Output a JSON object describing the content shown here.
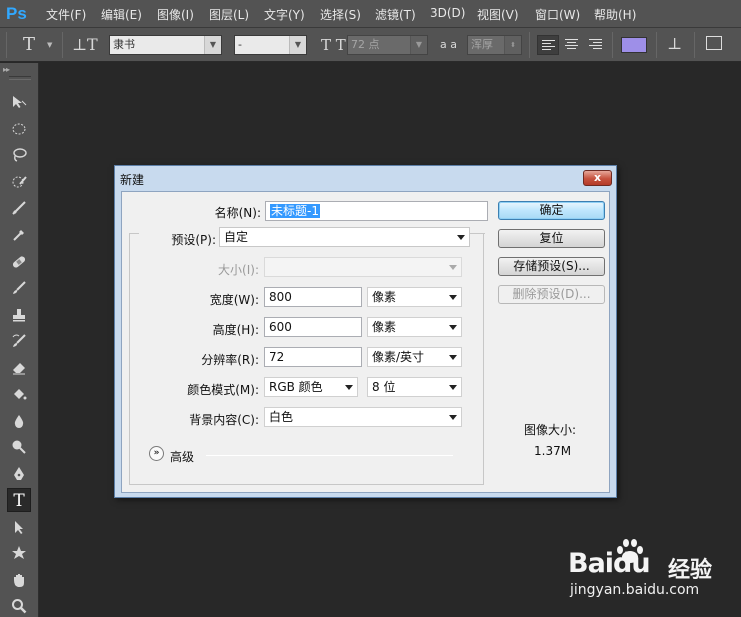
{
  "app": {
    "logo": "Ps"
  },
  "menu": [
    {
      "label": "文件(F)",
      "key": "file"
    },
    {
      "label": "编辑(E)",
      "key": "edit"
    },
    {
      "label": "图像(I)",
      "key": "image"
    },
    {
      "label": "图层(L)",
      "key": "layer"
    },
    {
      "label": "文字(Y)",
      "key": "type"
    },
    {
      "label": "选择(S)",
      "key": "select"
    },
    {
      "label": "滤镜(T)",
      "key": "filter"
    },
    {
      "label": "3D(D)",
      "key": "3d"
    },
    {
      "label": "视图(V)",
      "key": "view"
    },
    {
      "label": "窗口(W)",
      "key": "window"
    },
    {
      "label": "帮助(H)",
      "key": "help"
    }
  ],
  "options_bar": {
    "font_family": "隶书",
    "font_style": "-",
    "font_size": "72 点",
    "aa_icon": "a a",
    "antialias": "浑厚",
    "text_color": "#9e8fe8"
  },
  "toolbox": {
    "grip": "▸▸",
    "tools": [
      {
        "name": "move-tool",
        "icon": "move-icon"
      },
      {
        "name": "marquee-tool",
        "icon": "ellipse-marquee-icon"
      },
      {
        "name": "lasso-tool",
        "icon": "lasso-icon"
      },
      {
        "name": "quick-select-tool",
        "icon": "quick-select-icon"
      },
      {
        "name": "crop-tool",
        "icon": "crop-icon"
      },
      {
        "name": "eyedropper-tool",
        "icon": "eyedropper-icon"
      },
      {
        "name": "healing-tool",
        "icon": "bandage-icon"
      },
      {
        "name": "brush-tool",
        "icon": "brush-icon"
      },
      {
        "name": "stamp-tool",
        "icon": "stamp-icon"
      },
      {
        "name": "history-brush-tool",
        "icon": "history-brush-icon"
      },
      {
        "name": "eraser-tool",
        "icon": "eraser-icon"
      },
      {
        "name": "paint-bucket-tool",
        "icon": "paint-bucket-icon"
      },
      {
        "name": "blur-tool",
        "icon": "drop-icon"
      },
      {
        "name": "dodge-tool",
        "icon": "dodge-icon"
      },
      {
        "name": "pen-tool",
        "icon": "pen-icon"
      },
      {
        "name": "type-tool",
        "icon": "type-icon",
        "active": true
      },
      {
        "name": "path-select-tool",
        "icon": "arrow-icon"
      },
      {
        "name": "shape-tool",
        "icon": "custom-shape-icon"
      },
      {
        "name": "hand-tool",
        "icon": "hand-icon"
      },
      {
        "name": "zoom-tool",
        "icon": "magnifier-icon"
      }
    ]
  },
  "dialog": {
    "title": "新建",
    "close": "x",
    "name_label": "名称(N):",
    "name_value": "未标题-1",
    "preset_label": "预设(P):",
    "preset_value": "自定",
    "size_label": "大小(I):",
    "width_label": "宽度(W):",
    "width_value": "800",
    "width_unit": "像素",
    "height_label": "高度(H):",
    "height_value": "600",
    "height_unit": "像素",
    "resolution_label": "分辨率(R):",
    "resolution_value": "72",
    "resolution_unit": "像素/英寸",
    "color_mode_label": "颜色模式(M):",
    "color_mode_value": "RGB 颜色",
    "bit_depth_value": "8 位",
    "background_label": "背景内容(C):",
    "background_value": "白色",
    "advanced_label": "高级",
    "advanced_toggle": "»",
    "buttons": {
      "ok": "确定",
      "reset": "复位",
      "save_preset": "存储预设(S)...",
      "delete_preset": "删除预设(D)..."
    },
    "image_size_label": "图像大小:",
    "image_size_value": "1.37M"
  },
  "watermark": {
    "brand": "Baidu",
    "product": "经验",
    "url": "jingyan.baidu.com"
  }
}
